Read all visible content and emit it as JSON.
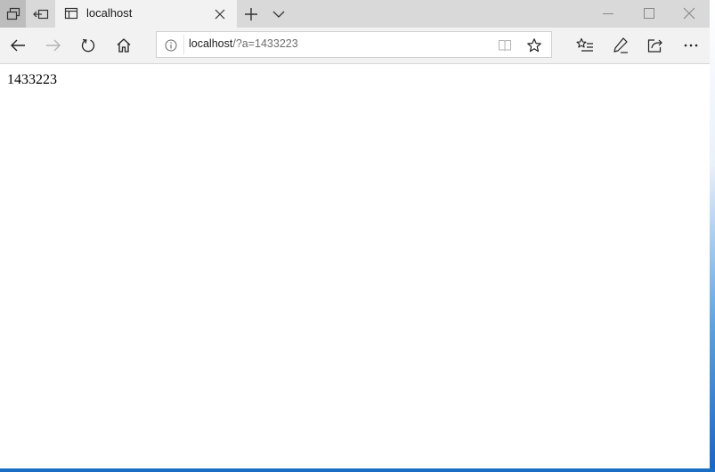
{
  "browser": {
    "tab": {
      "title": "localhost"
    },
    "address_bar": {
      "url_host": "localhost",
      "url_rest": "/?a=1433223"
    },
    "icons": {
      "tab_preview": "tab-preview-icon",
      "set_tabs_aside": "set-tabs-aside-icon",
      "page": "page-icon",
      "close_tab": "close-icon",
      "new_tab": "plus-icon",
      "tab_options": "chevron-down-icon",
      "minimize": "minimize-icon",
      "maximize": "maximize-icon",
      "close_window": "close-icon",
      "back": "back-arrow-icon",
      "forward": "forward-arrow-icon",
      "refresh": "refresh-icon",
      "home": "home-icon",
      "site_info": "info-icon",
      "reading_view": "book-icon",
      "favorite": "star-icon",
      "favorites_hub": "favorites-list-icon",
      "web_note": "pen-icon",
      "share": "share-icon",
      "more": "more-icon"
    },
    "colors": {
      "tab_bar": "#d9d9d9",
      "toolbar": "#f2f2f2",
      "desktop_accent": "#1a6fc4"
    }
  },
  "page": {
    "text": "1433223"
  }
}
